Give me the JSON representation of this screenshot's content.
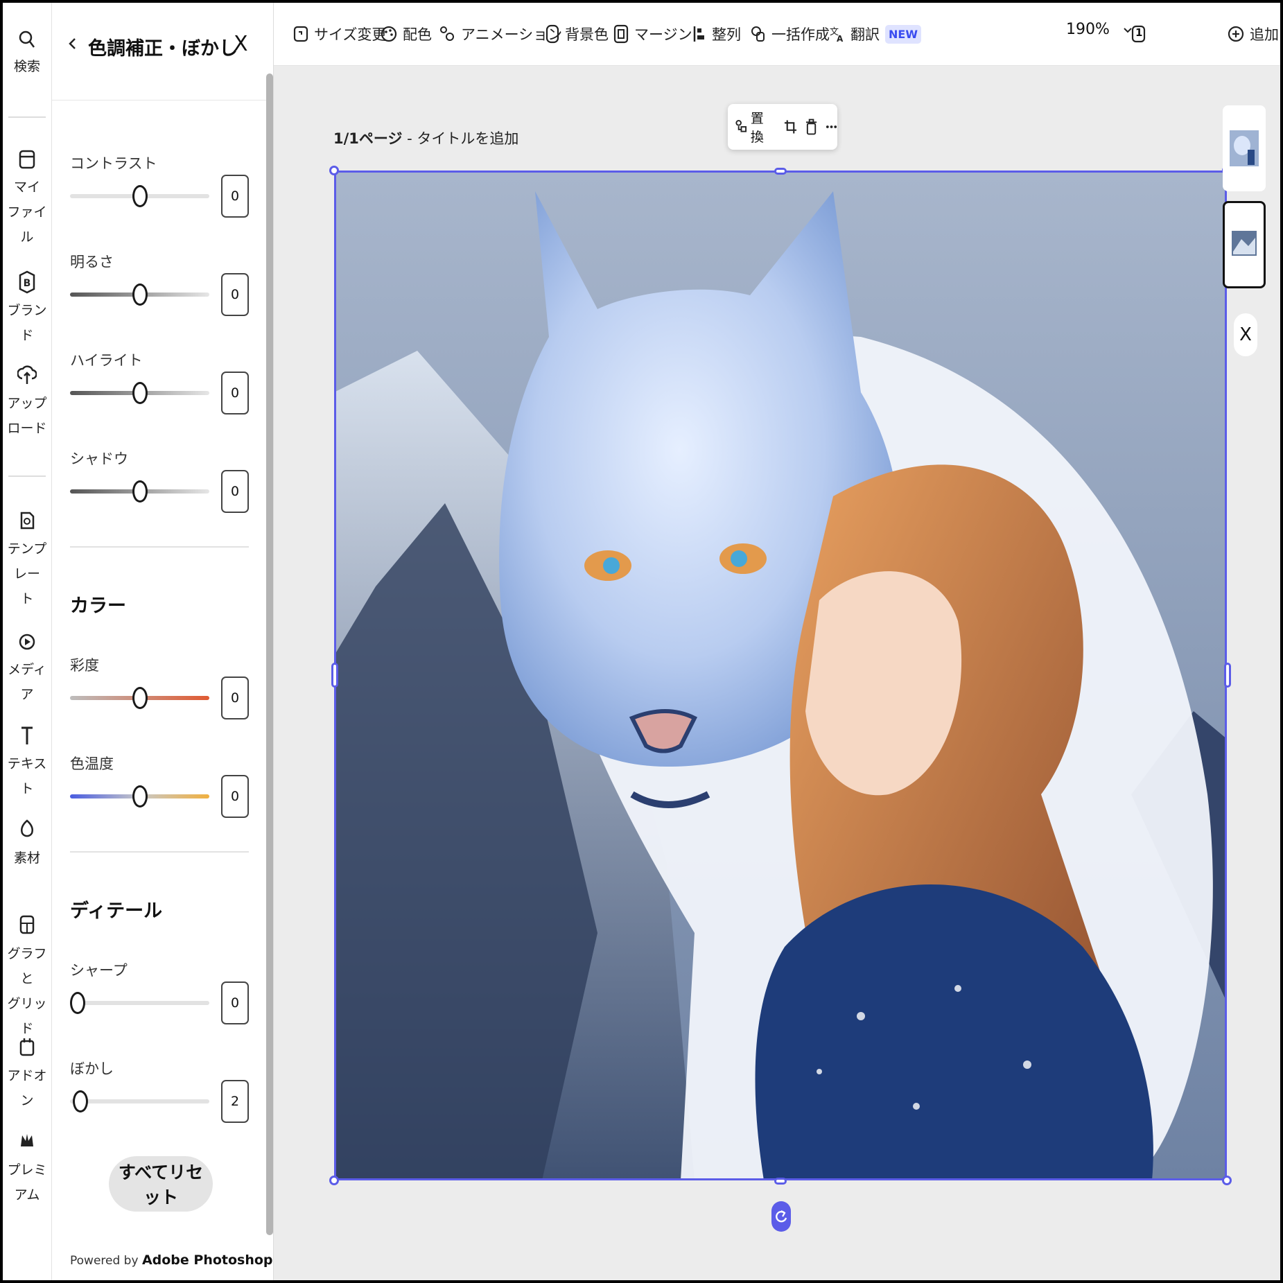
{
  "rail": {
    "items": [
      {
        "label": "検索",
        "icon": "search-icon"
      },
      {
        "label": "マイ\nファイル",
        "icon": "folder-icon"
      },
      {
        "label": "ブランド",
        "icon": "brand-icon"
      },
      {
        "label": "アップ\nロード",
        "icon": "upload-icon"
      },
      {
        "label": "テンプレー\nト",
        "icon": "template-icon"
      },
      {
        "label": "メディア",
        "icon": "media-icon"
      },
      {
        "label": "テキスト",
        "icon": "text-icon"
      },
      {
        "label": "素材",
        "icon": "elements-icon"
      },
      {
        "label": "グラフと\nグリッド",
        "icon": "grid-icon"
      },
      {
        "label": "アドオン",
        "icon": "addon-icon"
      },
      {
        "label": "プレミアム",
        "icon": "crown-icon"
      }
    ]
  },
  "panel": {
    "title": "色調補正・ぼかし",
    "controls": [
      {
        "label": "コントラスト",
        "value": "0"
      },
      {
        "label": "明るさ",
        "value": "0"
      },
      {
        "label": "ハイライト",
        "value": "0"
      },
      {
        "label": "シャドウ",
        "value": "0"
      },
      {
        "label": "彩度",
        "value": "0"
      },
      {
        "label": "色温度",
        "value": "0"
      },
      {
        "label": "シャープ",
        "value": "0"
      },
      {
        "label": "ぼかし",
        "value": "2"
      }
    ],
    "section_color": "カラー",
    "section_detail": "ディテール",
    "reset_label": "すべてリセット",
    "powered_prefix": "Powered by ",
    "powered_brand": "Adobe Photoshop"
  },
  "toolbar": {
    "items": [
      {
        "label": "サイズ変更",
        "icon": "resize-icon"
      },
      {
        "label": "配色",
        "icon": "palette-icon"
      },
      {
        "label": "アニメーション",
        "icon": "animation-icon"
      },
      {
        "label": "背景色",
        "icon": "background-icon"
      },
      {
        "label": "マージン",
        "icon": "margin-icon"
      },
      {
        "label": "整列",
        "icon": "align-icon"
      },
      {
        "label": "一括作成",
        "icon": "batch-icon"
      },
      {
        "label": "翻訳",
        "icon": "translate-icon"
      }
    ],
    "new_badge": "NEW",
    "zoom": "190%",
    "page_count": "1",
    "add_label": "追加"
  },
  "canvas": {
    "page_label": "1/1ページ",
    "page_sep": " - ",
    "title_placeholder": "タイトルを追加",
    "float_replace": "置換",
    "accent": "#5b5ce8"
  }
}
